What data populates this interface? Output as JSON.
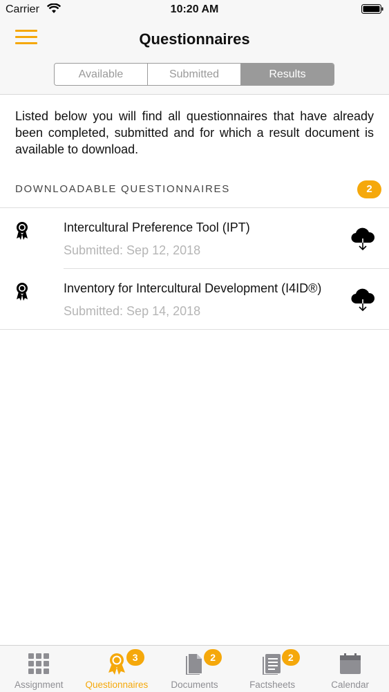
{
  "status_bar": {
    "carrier": "Carrier",
    "time": "10:20 AM"
  },
  "nav": {
    "title": "Questionnaires"
  },
  "segments": [
    {
      "label": "Available",
      "active": false
    },
    {
      "label": "Submitted",
      "active": false
    },
    {
      "label": "Results",
      "active": true
    }
  ],
  "intro_text": "Listed below you will find all questionnaires that have already been completed, submitted and for which a result document is available to download.",
  "section": {
    "label": "DOWNLOADABLE QUESTIONNAIRES",
    "count": "2"
  },
  "items": [
    {
      "title": "Intercultural Preference Tool (IPT)",
      "subtitle": "Submitted: Sep 12, 2018"
    },
    {
      "title": "Inventory for Intercultural Development (I4ID®)",
      "subtitle": "Submitted: Sep 14, 2018"
    }
  ],
  "tabs": [
    {
      "label": "Assignment",
      "icon": "grid-icon",
      "badge": ""
    },
    {
      "label": "Questionnaires",
      "icon": "award-icon",
      "badge": "3",
      "active": true
    },
    {
      "label": "Documents",
      "icon": "document-icon",
      "badge": "2"
    },
    {
      "label": "Factsheets",
      "icon": "factsheet-icon",
      "badge": "2"
    },
    {
      "label": "Calendar",
      "icon": "calendar-icon",
      "badge": ""
    }
  ],
  "colors": {
    "accent": "#f5a80b",
    "segment_gray": "#9a9a9a",
    "subtitle_gray": "#b5b5b5"
  }
}
